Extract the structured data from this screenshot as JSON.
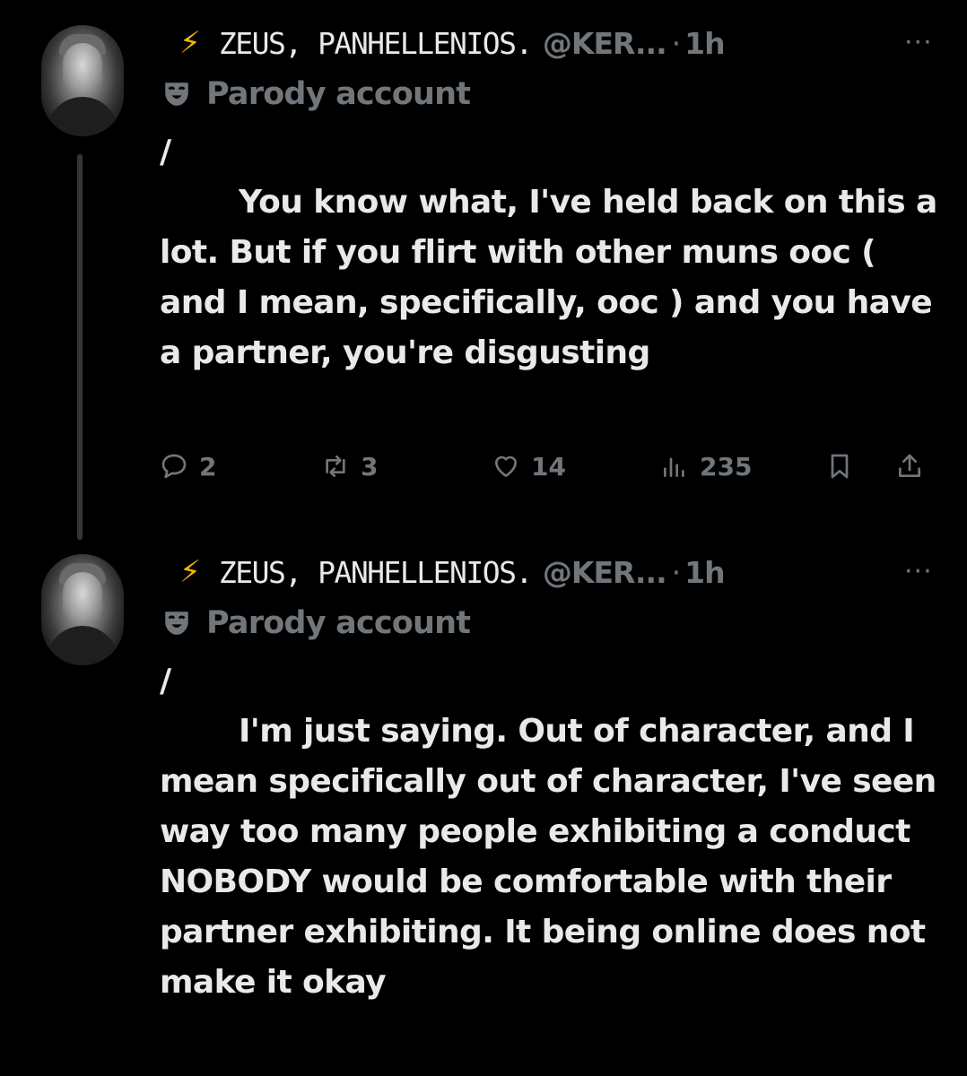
{
  "tweets": [
    {
      "display_name": "ZEUS, PANHELLENIOS.",
      "handle": "@KER...",
      "separator": "·",
      "time": "1h",
      "badge": "Parody account",
      "slash": "/",
      "body": "You know what, I've held back on this a lot. But if you flirt with other muns ooc ( and I mean, specifically, ooc ) and you have a partner, you're disgusting",
      "replies": "2",
      "reposts": "3",
      "likes": "14",
      "views": "235",
      "show_actions": true
    },
    {
      "display_name": "ZEUS, PANHELLENIOS.",
      "handle": "@KER...",
      "separator": "·",
      "time": "1h",
      "badge": "Parody account",
      "slash": "/",
      "body": "I'm just saying. Out of character, and I mean specifically out of character, I've seen way too many people exhibiting a conduct NOBODY would be comfortable with their partner exhibiting. It being online does not make it okay",
      "show_actions": false
    }
  ],
  "icons": {
    "name_prefix": "⚡",
    "more": "···",
    "badge_icon": "theater-mask-icon",
    "reply": "reply-icon",
    "repost": "repost-icon",
    "like": "heart-icon",
    "views": "views-icon",
    "bookmark": "bookmark-icon",
    "share": "share-icon"
  },
  "colors": {
    "background": "#000000",
    "text": "#e7e9ea",
    "muted": "#71767b",
    "bolt": "#f4b400"
  }
}
